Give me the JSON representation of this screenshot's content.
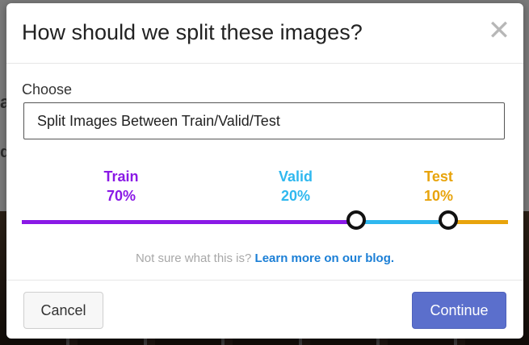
{
  "background": {
    "partial_letters": [
      "a",
      "d"
    ]
  },
  "modal": {
    "title": "How should we split these images?",
    "close_icon": "close-icon",
    "choose_label": "Choose",
    "select_value": "Split Images Between Train/Valid/Test",
    "splits": [
      {
        "name": "Train",
        "percent_label": "70%",
        "percent": 70,
        "color": "#8a19e6"
      },
      {
        "name": "Valid",
        "percent_label": "20%",
        "percent": 20,
        "color": "#2fb8ef"
      },
      {
        "name": "Test",
        "percent_label": "10%",
        "percent": 10,
        "color": "#e8a40c"
      }
    ],
    "help_text": "Not sure what this is?",
    "help_link": "Learn more on our blog.",
    "cancel_label": "Cancel",
    "continue_label": "Continue",
    "accent_color": "#5b6fcc"
  }
}
